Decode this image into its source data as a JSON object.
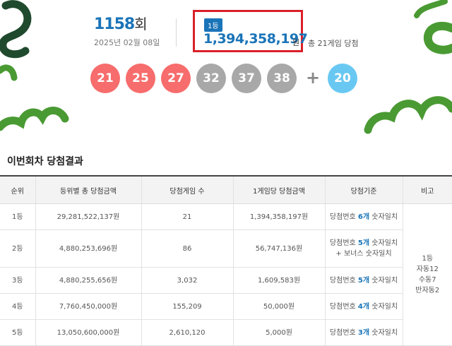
{
  "header": {
    "draw_number": "1158",
    "draw_suffix": "회",
    "draw_date": "2025년 02월 08일",
    "first_prize": {
      "rank_badge": "1등",
      "amount": "1,394,358,197",
      "unit": "원",
      "games": "총 21게임 당첨"
    }
  },
  "balls": [
    {
      "number": "21",
      "color": "#f76c6c"
    },
    {
      "number": "25",
      "color": "#f76c6c"
    },
    {
      "number": "27",
      "color": "#f76c6c"
    },
    {
      "number": "32",
      "color": "#a8a8a8"
    },
    {
      "number": "37",
      "color": "#a8a8a8"
    },
    {
      "number": "38",
      "color": "#a8a8a8"
    }
  ],
  "plus": "+",
  "bonus_ball": {
    "number": "20",
    "color": "#69c8f2"
  },
  "section_title": "이번회차 당첨결과",
  "table": {
    "headers": [
      "순위",
      "등위별 총 당첨금액",
      "당첨게임 수",
      "1게임당 당첨금액",
      "당첨기준",
      "비고"
    ],
    "rows": [
      {
        "rank": "1등",
        "total": "29,281,522,137원",
        "games": "21",
        "per_game": "1,394,358,197원",
        "crit_pre": "당첨번호 ",
        "crit_num": "6개",
        "crit_post": " 숫자일치",
        "crit_extra": ""
      },
      {
        "rank": "2등",
        "total": "4,880,253,696원",
        "games": "86",
        "per_game": "56,747,136원",
        "crit_pre": "당첨번호 ",
        "crit_num": "5개",
        "crit_post": " 숫자일치",
        "crit_extra": "+ 보너스 숫자일치"
      },
      {
        "rank": "3등",
        "total": "4,880,255,656원",
        "games": "3,032",
        "per_game": "1,609,583원",
        "crit_pre": "당첨번호 ",
        "crit_num": "5개",
        "crit_post": " 숫자일치",
        "crit_extra": ""
      },
      {
        "rank": "4등",
        "total": "7,760,450,000원",
        "games": "155,209",
        "per_game": "50,000원",
        "crit_pre": "당첨번호 ",
        "crit_num": "4개",
        "crit_post": " 숫자일치",
        "crit_extra": ""
      },
      {
        "rank": "5등",
        "total": "13,050,600,000원",
        "games": "2,610,120",
        "per_game": "5,000원",
        "crit_pre": "당첨번호 ",
        "crit_num": "3개",
        "crit_post": " 숫자일치",
        "crit_extra": ""
      }
    ],
    "note": [
      "1등",
      "자동12",
      "수동7",
      "반자동2"
    ]
  },
  "colors": {
    "accent_blue": "#1a74b8",
    "highlight_red": "#d9202a",
    "decor_green": "#4a9a33",
    "decor_dark_green": "#204a2e"
  }
}
